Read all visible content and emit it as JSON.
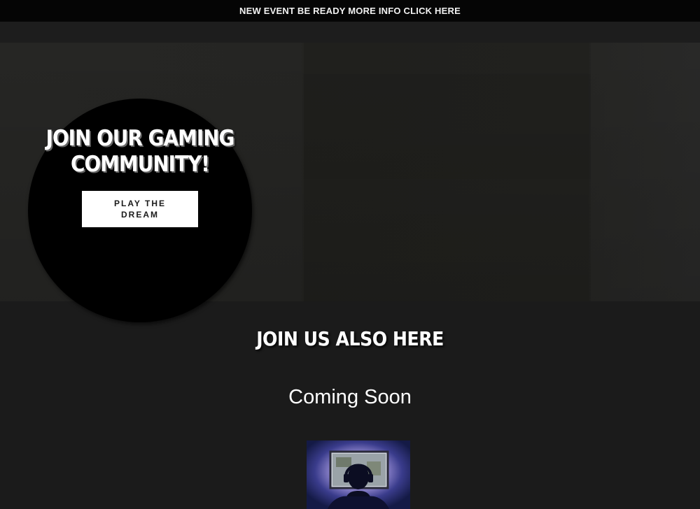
{
  "announcement": {
    "text": "NEW EVENT BE READY MORE INFO CLICK HERE"
  },
  "hero": {
    "title": "JOIN OUR GAMING COMMUNITY!",
    "cta_label": "PLAY THE DREAM"
  },
  "section": {
    "title": "JOIN US ALSO HERE",
    "subtitle": "Coming Soon"
  },
  "colors": {
    "page_bg": "#1b1b1b",
    "announce_bg": "#050505",
    "circle_bg": "#000000",
    "button_bg": "#ffffff",
    "text": "#ffffff"
  }
}
